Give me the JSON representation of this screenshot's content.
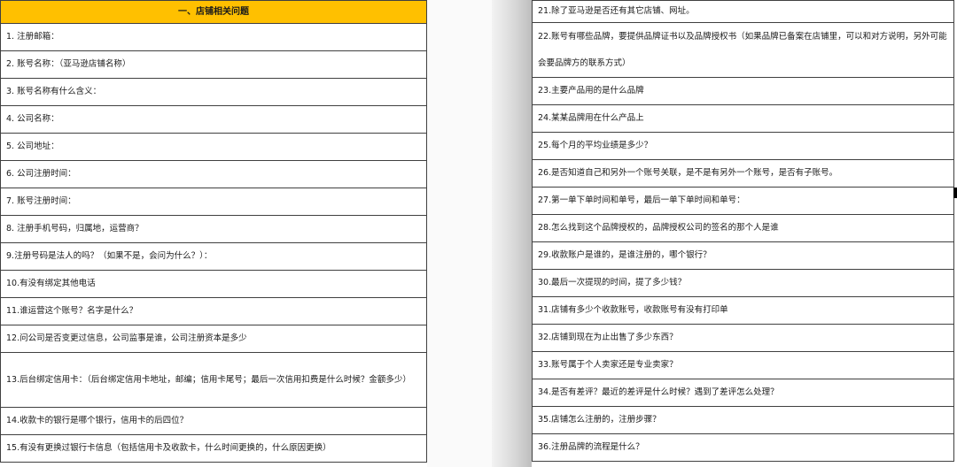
{
  "left": {
    "header": "一、店铺相关问题",
    "items": [
      "1. 注册邮箱：",
      "2. 账号名称：（亚马逊店铺名称）",
      "3. 账号名称有什么含义：",
      "4. 公司名称：",
      "5. 公司地址：",
      "6. 公司注册时间：",
      "7. 账号注册时间：",
      "8. 注册手机号码，归属地，运营商？",
      "9.注册号码是法人的吗？（如果不是，会问为什么？）：",
      "10.有没有绑定其他电话",
      "11.谁运营这个账号？名字是什么？",
      "12.问公司是否变更过信息，公司监事是谁，公司注册资本是多少",
      "13.后台绑定信用卡：（后台绑定信用卡地址，邮编；信用卡尾号；最后一次信用扣费是什么时候？金额多少）",
      "14.收款卡的银行是哪个银行，信用卡的后四位？",
      "15.有没有更换过银行卡信息（包括信用卡及收款卡，什么时间更换的，什么原因更换）"
    ]
  },
  "right": {
    "items": [
      "21.除了亚马逊是否还有其它店铺、网址。",
      "22.账号有哪些品牌，要提供品牌证书以及品牌授权书（如果品牌已备案在店铺里，可以和对方说明，另外可能会要品牌方的联系方式）",
      "23.主要产品用的是什么品牌",
      "24.某某品牌用在什么产品上",
      "25.每个月的平均业绩是多少？",
      "26.是否知道自己和另外一个账号关联，是不是有另外一个账号，是否有子账号。",
      "27.第一单下单时间和单号，最后一单下单时间和单号：",
      "28.怎么找到这个品牌授权的，品牌授权公司的签名的那个人是谁",
      "29.收款账户是谁的，是谁注册的，哪个银行？",
      "30.最后一次提现的时间，提了多少钱？",
      "31.店铺有多少个收款账号，收款账号有没有打印单",
      "32.店铺到现在为止出售了多少东西？",
      "33.账号属于个人卖家还是专业卖家？",
      "34.是否有差评？最近的差评是什么时候？遇到了差评怎么处理？",
      "35.店铺怎么注册的，注册步骤？",
      "36.注册品牌的流程是什么？"
    ]
  }
}
